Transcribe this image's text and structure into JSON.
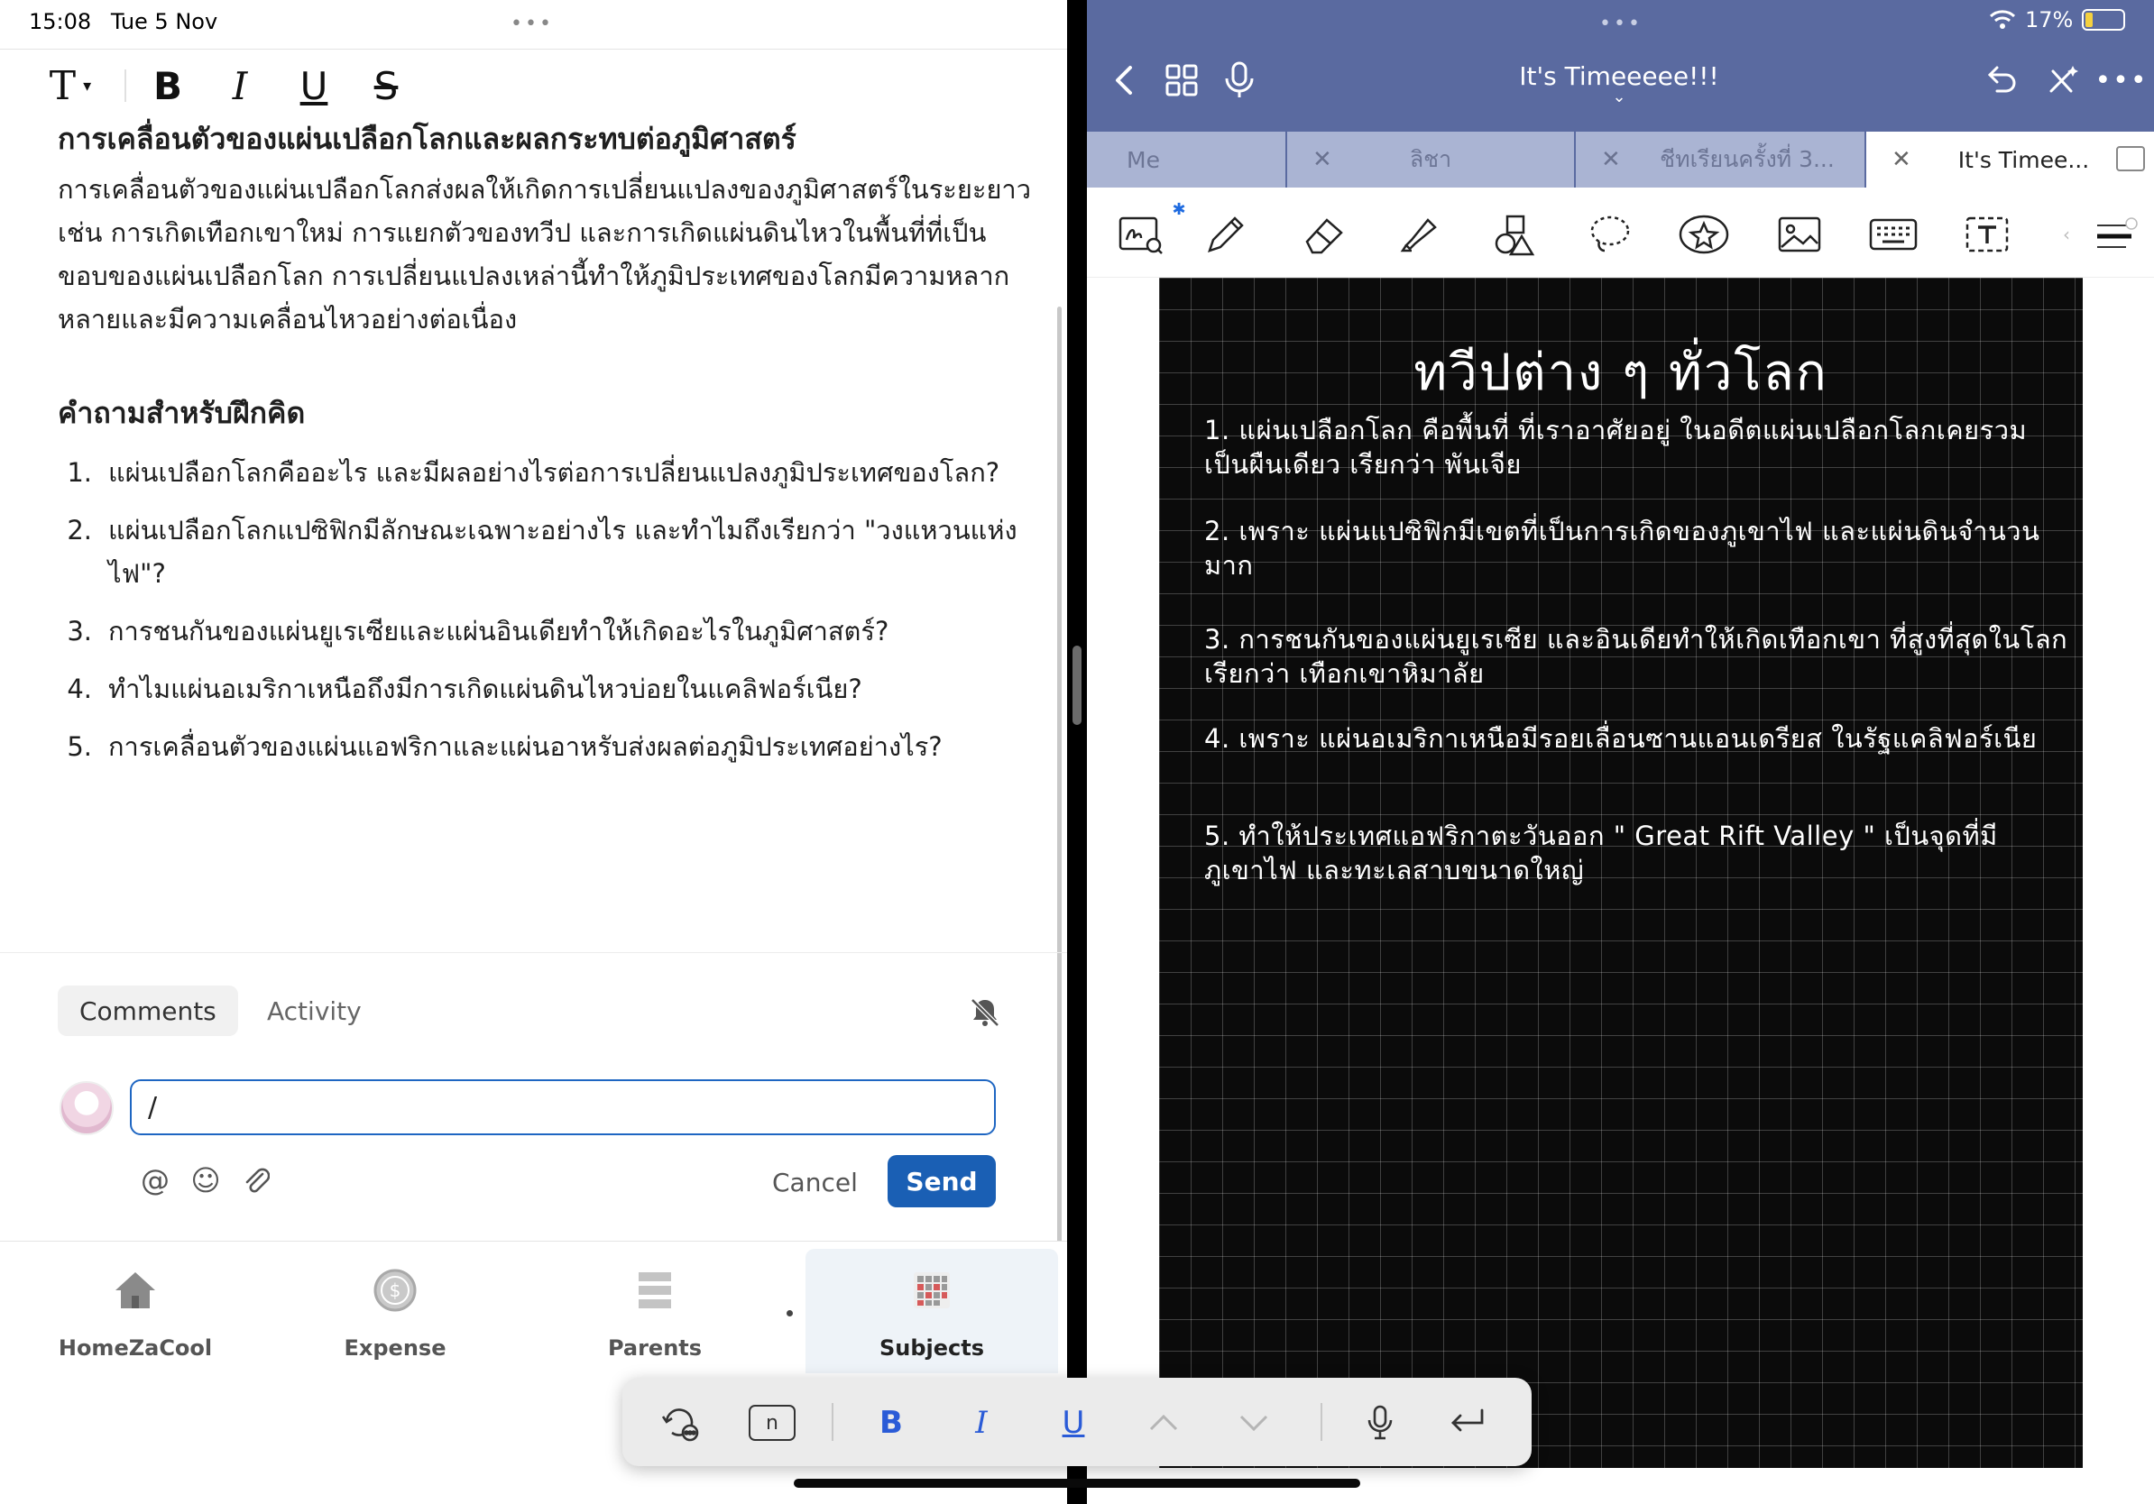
{
  "status": {
    "time": "15:08",
    "date": "Tue 5 Nov",
    "battery": "17%"
  },
  "left": {
    "format_bar": {
      "text_style": "T",
      "bold": "B",
      "italic": "I",
      "underline": "U",
      "strike": "S"
    },
    "doc": {
      "heading": "การเคลื่อนตัวของแผ่นเปลือกโลกและผลกระทบต่อภูมิศาสตร์",
      "body": "การเคลื่อนตัวของแผ่นเปลือกโลกส่งผลให้เกิดการเปลี่ยนแปลงของภูมิศาสตร์ในระยะยาว เช่น การเกิดเทือกเขาใหม่ การแยกตัวของทวีป และการเกิดแผ่นดินไหวในพื้นที่ที่เป็นขอบของแผ่นเปลือกโลก การเปลี่ยนแปลงเหล่านี้ทำให้ภูมิประเทศของโลกมีความหลากหลายและมีความเคลื่อนไหวอย่างต่อเนื่อง",
      "questions_heading": "คำถามสำหรับฝึกคิด",
      "questions": [
        {
          "num": "1.",
          "text": "แผ่นเปลือกโลกคืออะไร และมีผลอย่างไรต่อการเปลี่ยนแปลงภูมิประเทศของโลก?"
        },
        {
          "num": "2.",
          "text": "แผ่นเปลือกโลกแปซิฟิกมีลักษณะเฉพาะอย่างไร และทำไมถึงเรียกว่า \"วงแหวนแห่งไฟ\"?"
        },
        {
          "num": "3.",
          "text": "การชนกันของแผ่นยูเรเซียและแผ่นอินเดียทำให้เกิดอะไรในภูมิศาสตร์?"
        },
        {
          "num": "4.",
          "text": "ทำไมแผ่นอเมริกาเหนือถึงมีการเกิดแผ่นดินไหวบ่อยในแคลิฟอร์เนีย?"
        },
        {
          "num": "5.",
          "text": "การเคลื่อนตัวของแผ่นแอฟริกาและแผ่นอาหรับส่งผลต่อภูมิประเทศอย่างไร?"
        }
      ]
    },
    "comments": {
      "tab_comments": "Comments",
      "tab_activity": "Activity",
      "input_value": "/",
      "cancel": "Cancel",
      "send": "Send"
    },
    "nav": [
      {
        "label": "HomeZaCool",
        "icon": "house-icon"
      },
      {
        "label": "Expense",
        "icon": "coin-icon"
      },
      {
        "label": "Parents",
        "icon": "list-icon"
      },
      {
        "label": "Subjects",
        "icon": "calendar-grid-icon",
        "active": true
      }
    ]
  },
  "right": {
    "title": "It's Timeeeee!!!",
    "tabs": [
      {
        "label": "Me"
      },
      {
        "label": "ลิชา"
      },
      {
        "label": "ชีทเรียนครั้งที่ 3..."
      },
      {
        "label": "It's Timee...",
        "active": true
      }
    ],
    "notebook": {
      "title": "ทวีปต่าง ๆ ทั่วโลก",
      "items": [
        "1. แผ่นเปลือกโลก คือพื้นที่ ที่เราอาศัยอยู่ ในอดีตแผ่นเปลือกโลกเคยรวมเป็นผืนเดียว เรียกว่า พันเจีย",
        "2. เพราะ แผ่นแปซิฟิกมีเขตที่เป็นการเกิดของภูเขาไฟ และแผ่นดินจำนวนมาก",
        "3. การชนกันของแผ่นยูเรเซีย และอินเดียทำให้เกิดเทือกเขา ที่สูงที่สุดในโลก เรียกว่า เทือกเขาหิมาลัย",
        "4. เพราะ แผ่นอเมริกาเหนือมีรอยเลื่อนซานแอนเดรียส ในรัฐแคลิฟอร์เนีย",
        "5. ทำให้ประเทศแอฟริกาตะวันออก \" Great Rift Valley \" เป็นจุดที่มีภูเขาไฟ และทะเลสาบขนาดใหญ่"
      ]
    },
    "keyboard_bar": {
      "bold": "B",
      "italic": "I",
      "underline": "U",
      "key_n": "n"
    },
    "colors": {
      "header": "#5a6aa0",
      "tab_inactive": "#aab4d3",
      "accent_blue": "#1a5fb4"
    }
  }
}
